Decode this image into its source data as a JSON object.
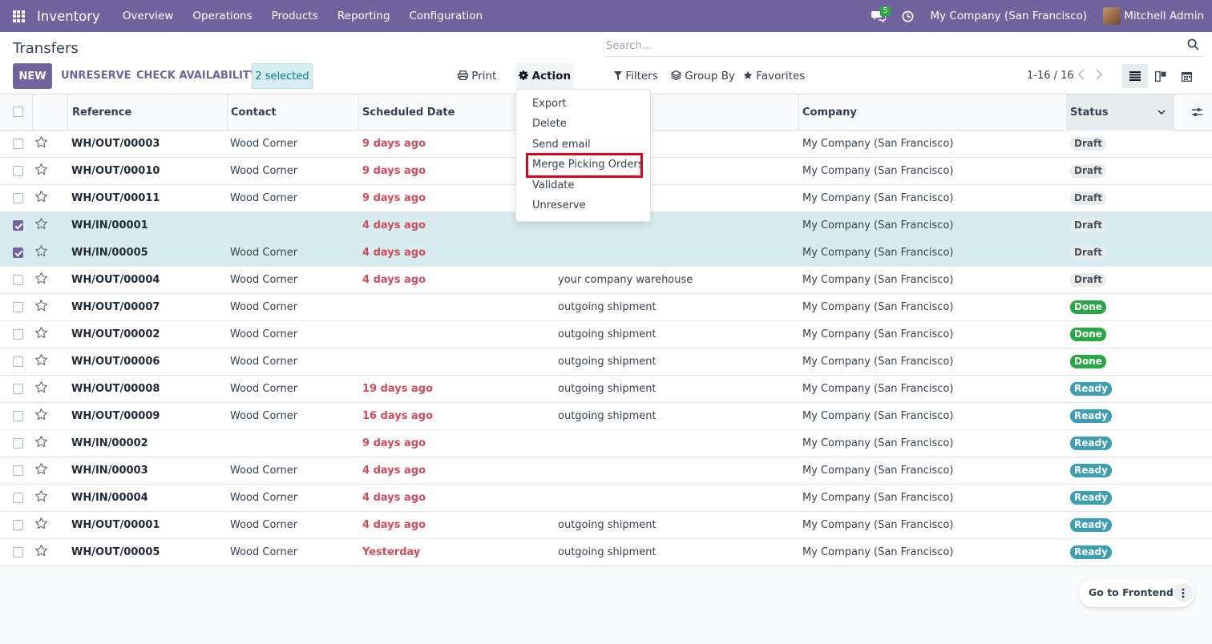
{
  "navbar": {
    "app_name": "Inventory",
    "menu": [
      "Overview",
      "Operations",
      "Products",
      "Reporting",
      "Configuration"
    ],
    "chat_count": "5",
    "company": "My Company (San Francisco)",
    "user": "Mitchell Admin"
  },
  "control_panel": {
    "title": "Transfers",
    "new_label": "NEW",
    "unreserve_label": "UNRESERVE",
    "check_availability_label": "CHECK AVAILABILITY",
    "selected_label": "2 selected",
    "print_label": "Print",
    "action_label": "Action",
    "search_placeholder": "Search...",
    "filters_label": "Filters",
    "group_by_label": "Group By",
    "favorites_label": "Favorites",
    "pager": "1-16 / 16"
  },
  "table": {
    "columns": [
      "Reference",
      "Contact",
      "Scheduled Date",
      "Company",
      "Status"
    ],
    "rows": [
      {
        "ref": "WH/OUT/00003",
        "contact": "Wood Corner",
        "date": "9 days ago",
        "source": "",
        "company": "My Company (San Francisco)",
        "status": "Draft",
        "selected": false
      },
      {
        "ref": "WH/OUT/00010",
        "contact": "Wood Corner",
        "date": "9 days ago",
        "source": "",
        "company": "My Company (San Francisco)",
        "status": "Draft",
        "selected": false
      },
      {
        "ref": "WH/OUT/00011",
        "contact": "Wood Corner",
        "date": "9 days ago",
        "source": "",
        "company": "My Company (San Francisco)",
        "status": "Draft",
        "selected": false
      },
      {
        "ref": "WH/IN/00001",
        "contact": "",
        "date": "4 days ago",
        "source": "",
        "company": "My Company (San Francisco)",
        "status": "Draft",
        "selected": true
      },
      {
        "ref": "WH/IN/00005",
        "contact": "Wood Corner",
        "date": "4 days ago",
        "source": "",
        "company": "My Company (San Francisco)",
        "status": "Draft",
        "selected": true
      },
      {
        "ref": "WH/OUT/00004",
        "contact": "Wood Corner",
        "date": "4 days ago",
        "source": "your company warehouse",
        "company": "My Company (San Francisco)",
        "status": "Draft",
        "selected": false
      },
      {
        "ref": "WH/OUT/00007",
        "contact": "Wood Corner",
        "date": "",
        "source": "outgoing shipment",
        "company": "My Company (San Francisco)",
        "status": "Done",
        "selected": false
      },
      {
        "ref": "WH/OUT/00002",
        "contact": "Wood Corner",
        "date": "",
        "source": "outgoing shipment",
        "company": "My Company (San Francisco)",
        "status": "Done",
        "selected": false
      },
      {
        "ref": "WH/OUT/00006",
        "contact": "Wood Corner",
        "date": "",
        "source": "outgoing shipment",
        "company": "My Company (San Francisco)",
        "status": "Done",
        "selected": false
      },
      {
        "ref": "WH/OUT/00008",
        "contact": "Wood Corner",
        "date": "19 days ago",
        "source": "outgoing shipment",
        "company": "My Company (San Francisco)",
        "status": "Ready",
        "selected": false
      },
      {
        "ref": "WH/OUT/00009",
        "contact": "Wood Corner",
        "date": "16 days ago",
        "source": "outgoing shipment",
        "company": "My Company (San Francisco)",
        "status": "Ready",
        "selected": false
      },
      {
        "ref": "WH/IN/00002",
        "contact": "",
        "date": "9 days ago",
        "source": "",
        "company": "My Company (San Francisco)",
        "status": "Ready",
        "selected": false
      },
      {
        "ref": "WH/IN/00003",
        "contact": "Wood Corner",
        "date": "4 days ago",
        "source": "",
        "company": "My Company (San Francisco)",
        "status": "Ready",
        "selected": false
      },
      {
        "ref": "WH/IN/00004",
        "contact": "Wood Corner",
        "date": "4 days ago",
        "source": "",
        "company": "My Company (San Francisco)",
        "status": "Ready",
        "selected": false
      },
      {
        "ref": "WH/OUT/00001",
        "contact": "Wood Corner",
        "date": "4 days ago",
        "source": "outgoing shipment",
        "company": "My Company (San Francisco)",
        "status": "Ready",
        "selected": false
      },
      {
        "ref": "WH/OUT/00005",
        "contact": "Wood Corner",
        "date": "Yesterday",
        "source": "outgoing shipment",
        "company": "My Company (San Francisco)",
        "status": "Ready",
        "selected": false
      }
    ]
  },
  "action_menu": {
    "items": [
      "Export",
      "Delete",
      "Send email",
      "Merge Picking Orders",
      "Validate",
      "Unreserve"
    ],
    "highlighted": "Merge Picking Orders"
  },
  "floating": {
    "go_frontend_label": "Go to Frontend"
  },
  "colors": {
    "brand": "#71639e",
    "danger_date": "#d44c59",
    "done": "#28a745",
    "ready": "#3d9fb3",
    "highlight_box": "#e0001b"
  }
}
